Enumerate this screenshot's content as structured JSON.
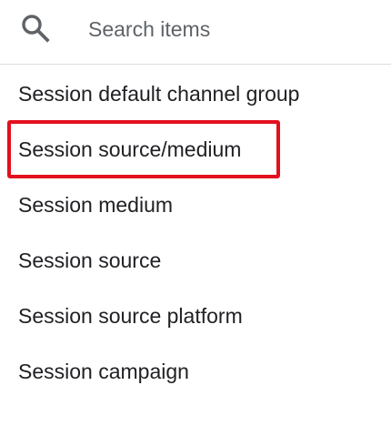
{
  "search": {
    "placeholder": "Search items",
    "icon": "search-icon"
  },
  "options": [
    {
      "label": "Session default channel group"
    },
    {
      "label": "Session source/medium",
      "highlighted": true
    },
    {
      "label": "Session medium"
    },
    {
      "label": "Session source"
    },
    {
      "label": "Session source platform"
    },
    {
      "label": "Session campaign"
    }
  ],
  "colors": {
    "text": "#202124",
    "placeholder": "#5f6368",
    "icon": "#5f6368",
    "divider": "#dadce0",
    "highlight": "#e3101e"
  }
}
